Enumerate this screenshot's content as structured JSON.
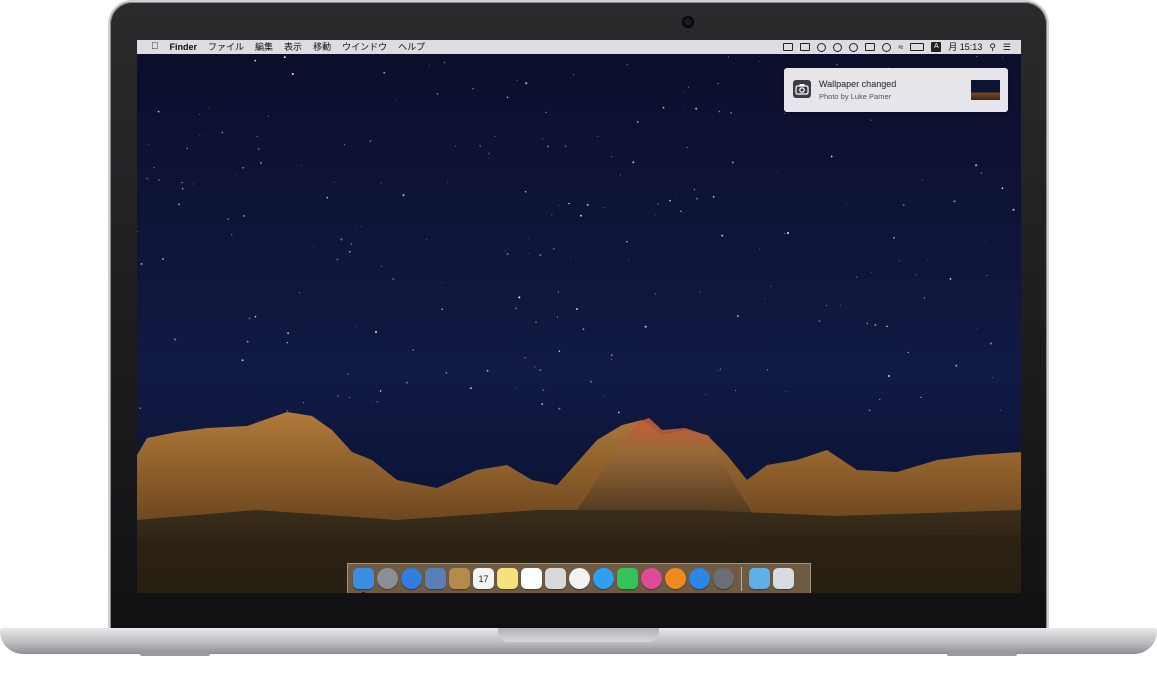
{
  "menubar": {
    "apple_icon": "apple-icon",
    "app_name": "Finder",
    "menus": [
      "ファイル",
      "編集",
      "表示",
      "移動",
      "ウインドウ",
      "ヘルプ"
    ],
    "status_icons": [
      "screen-mirror-icon",
      "battery-small-icon",
      "camera-icon",
      "paw-icon",
      "settings-icon",
      "box-icon",
      "half-circle-icon",
      "wifi-icon",
      "battery-icon"
    ],
    "input_source": "A",
    "clock": "月 15:13",
    "search_icon": "search-icon",
    "notification_center_icon": "list-icon"
  },
  "notification": {
    "title": "Wallpaper changed",
    "subtitle": "Photo by Luke Pamer",
    "icon": "camera-icon"
  },
  "dock": {
    "apps": [
      {
        "name": "finder",
        "color": "#3b8de0",
        "running": true
      },
      {
        "name": "launchpad",
        "color": "#8a8e96",
        "running": false
      },
      {
        "name": "safari",
        "color": "#2f7ee0",
        "running": false
      },
      {
        "name": "preview",
        "color": "#5a7fb8",
        "running": false
      },
      {
        "name": "contacts",
        "color": "#b58a4a",
        "running": false
      },
      {
        "name": "calendar",
        "color": "#f4f4f4",
        "running": false,
        "day": "17"
      },
      {
        "name": "notes",
        "color": "#f6e27a",
        "running": false
      },
      {
        "name": "reminders",
        "color": "#ffffff",
        "running": false
      },
      {
        "name": "photo-booth",
        "color": "#d9d9d9",
        "running": false
      },
      {
        "name": "photos",
        "color": "#f2f2f2",
        "running": false
      },
      {
        "name": "messages",
        "color": "#2fa0f0",
        "running": false
      },
      {
        "name": "facetime",
        "color": "#34c35a",
        "running": false
      },
      {
        "name": "itunes",
        "color": "#e04a9a",
        "running": false
      },
      {
        "name": "ibooks",
        "color": "#f08a1e",
        "running": false
      },
      {
        "name": "app-store",
        "color": "#2a86e8",
        "running": false
      },
      {
        "name": "system-preferences",
        "color": "#6b6e74",
        "running": false
      }
    ],
    "trailing": [
      {
        "name": "downloads",
        "color": "#5fb0e8"
      },
      {
        "name": "trash",
        "color": "#d8dbe0"
      }
    ]
  }
}
